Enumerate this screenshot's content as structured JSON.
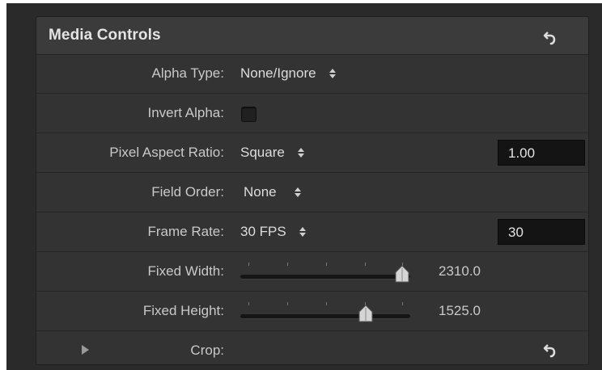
{
  "panel": {
    "title": "Media Controls",
    "reset_icon": "reset-arrow-icon"
  },
  "rows": {
    "alpha_type": {
      "label": "Alpha Type:",
      "value": "None/Ignore"
    },
    "invert_alpha": {
      "label": "Invert Alpha:",
      "checked": false
    },
    "pixel_aspect_ratio": {
      "label": "Pixel Aspect Ratio:",
      "value": "Square",
      "field_value": "1.00"
    },
    "field_order": {
      "label": "Field Order:",
      "value": "None"
    },
    "frame_rate": {
      "label": "Frame Rate:",
      "value": "30 FPS",
      "field_value": "30"
    },
    "fixed_width": {
      "label": "Fixed Width:",
      "value": "2310.0",
      "slider_fraction": 0.95
    },
    "fixed_height": {
      "label": "Fixed Height:",
      "value": "1525.0",
      "slider_fraction": 0.74
    },
    "crop": {
      "label": "Crop:",
      "reset_icon": "reset-arrow-icon",
      "disclosure_icon": "disclosure-triangle-icon"
    }
  },
  "colors": {
    "background": "#2a2a2a",
    "panel": "#333333",
    "header": "#3b3b3b",
    "text": "#c9c9c9",
    "field": "#141414"
  }
}
